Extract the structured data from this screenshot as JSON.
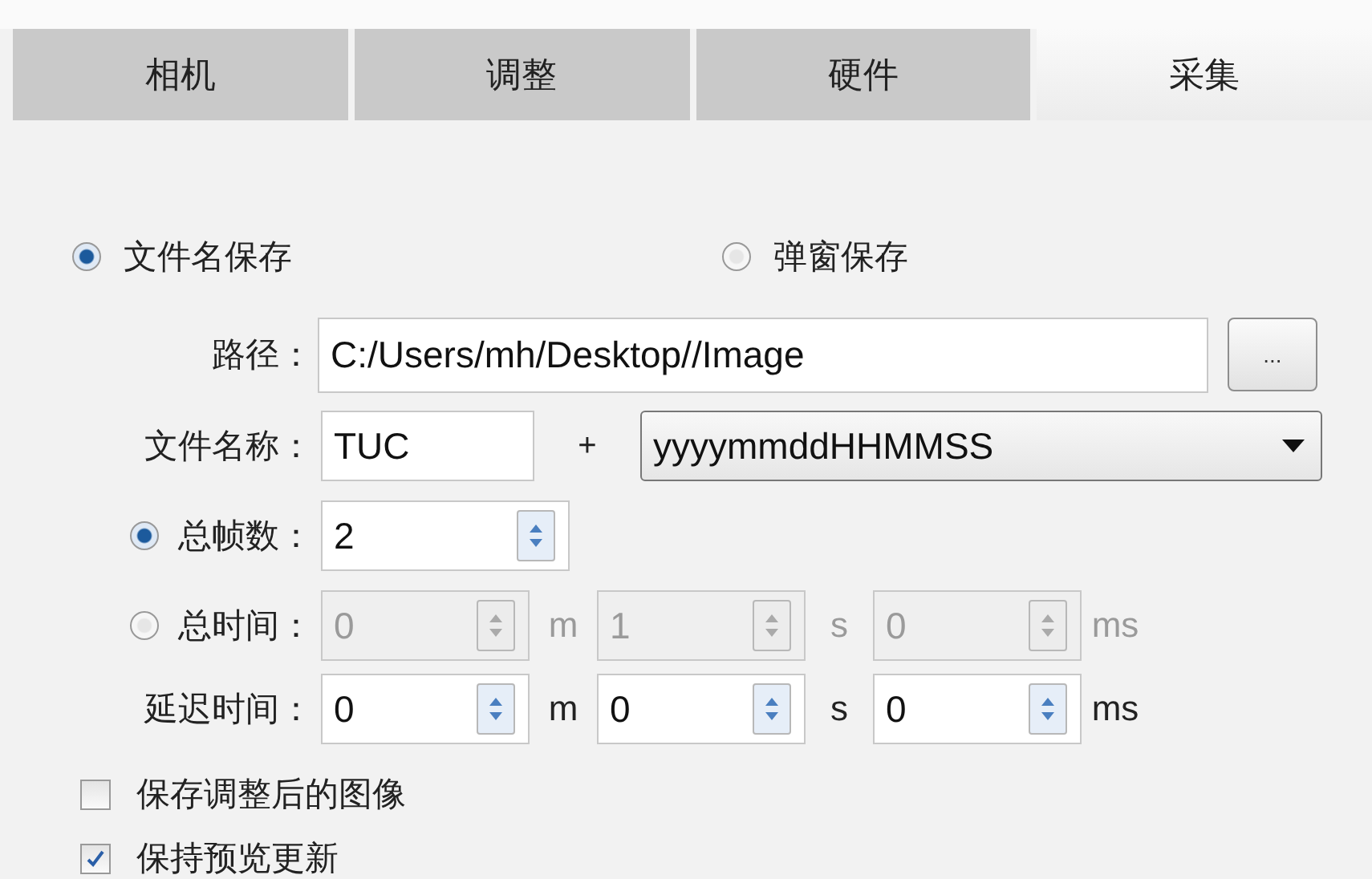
{
  "tabs": [
    {
      "label": "相机",
      "selected": false
    },
    {
      "label": "调整",
      "selected": false
    },
    {
      "label": "硬件",
      "selected": false
    },
    {
      "label": "采集",
      "selected": true
    }
  ],
  "save_mode": [
    {
      "label": "文件名保存",
      "selected": true
    },
    {
      "label": "弹窗保存",
      "selected": false
    }
  ],
  "path": {
    "label": "路径：",
    "value": "C:/Users/mh/Desktop//Image",
    "browse_button": "..."
  },
  "file_name": {
    "label": "文件名称：",
    "value": "TUC",
    "separator": "+",
    "format": "yyyymmddHHMMSS"
  },
  "total_frames": {
    "label": "总帧数：",
    "selected": true,
    "value": "2"
  },
  "total_time": {
    "label": "总时间：",
    "selected": false,
    "disabled": true,
    "fields": [
      {
        "value": "0",
        "unit": "m"
      },
      {
        "value": "1",
        "unit": "s"
      },
      {
        "value": "0",
        "unit": "ms"
      }
    ]
  },
  "delay": {
    "label": "延迟时间：",
    "disabled": false,
    "fields": [
      {
        "value": "0",
        "unit": "m"
      },
      {
        "value": "0",
        "unit": "s"
      },
      {
        "value": "0",
        "unit": "ms"
      }
    ]
  },
  "checkboxes": [
    {
      "label": "保存调整后的图像",
      "checked": false
    },
    {
      "label": "保持预览更新",
      "checked": true
    }
  ]
}
